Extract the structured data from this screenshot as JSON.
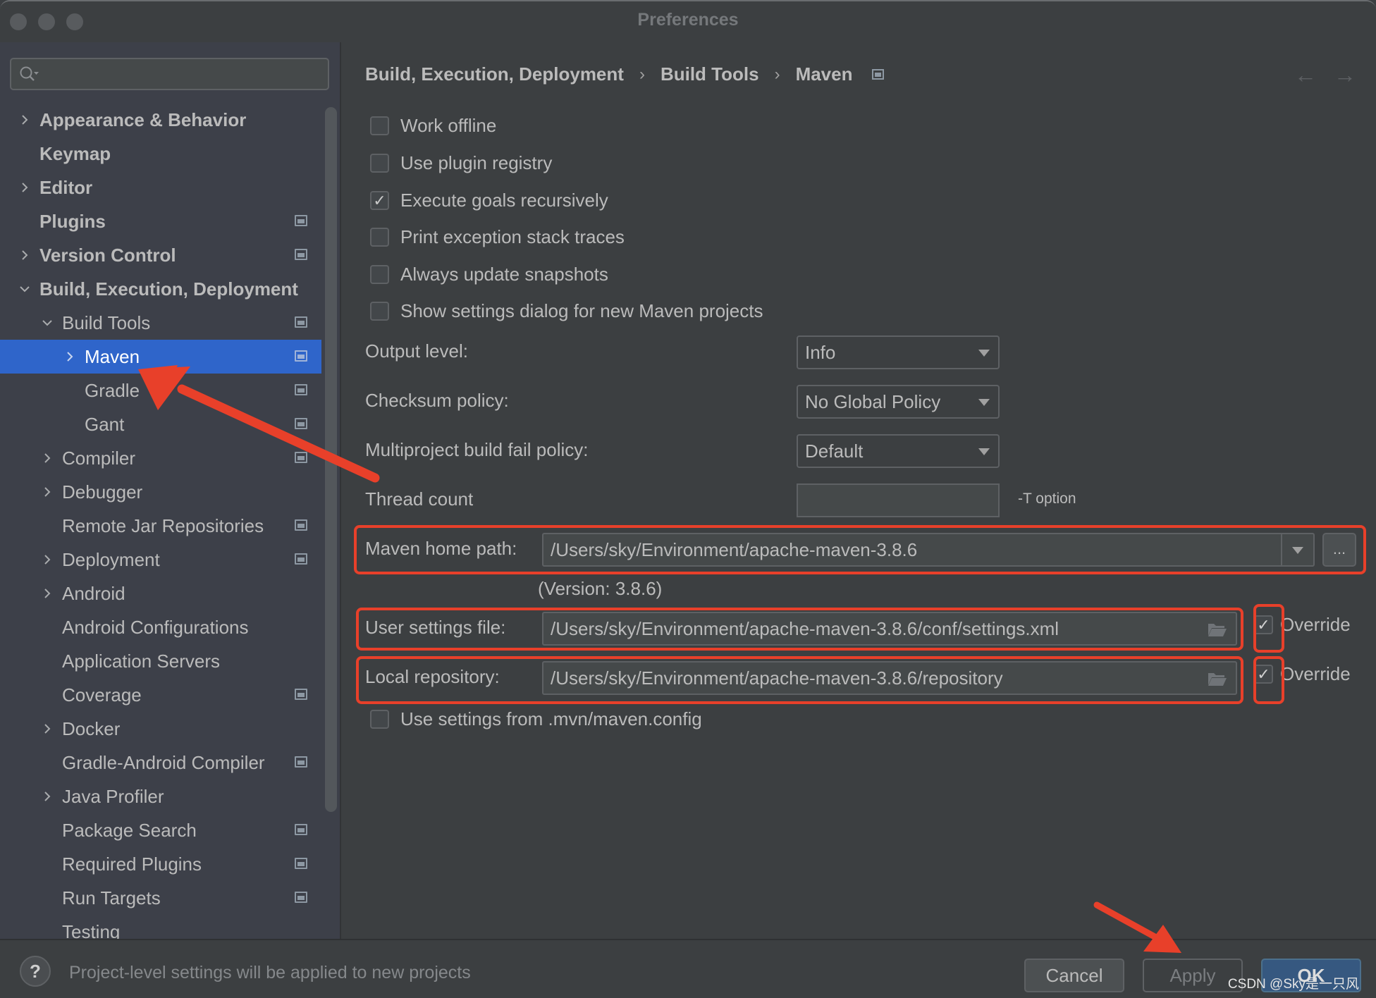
{
  "window": {
    "title": "Preferences"
  },
  "sidebar": {
    "search_placeholder": "",
    "items": [
      {
        "label": "Appearance & Behavior",
        "level": 0,
        "bold": true,
        "expander": "collapsed",
        "project_icon": false
      },
      {
        "label": "Keymap",
        "level": 0,
        "bold": true,
        "expander": "none",
        "project_icon": false
      },
      {
        "label": "Editor",
        "level": 0,
        "bold": true,
        "expander": "collapsed",
        "project_icon": false
      },
      {
        "label": "Plugins",
        "level": 0,
        "bold": true,
        "expander": "none",
        "project_icon": true
      },
      {
        "label": "Version Control",
        "level": 0,
        "bold": true,
        "expander": "collapsed",
        "project_icon": true
      },
      {
        "label": "Build, Execution, Deployment",
        "level": 0,
        "bold": true,
        "expander": "expanded",
        "project_icon": false
      },
      {
        "label": "Build Tools",
        "level": 1,
        "bold": false,
        "expander": "expanded",
        "project_icon": true
      },
      {
        "label": "Maven",
        "level": 2,
        "bold": false,
        "expander": "collapsed",
        "project_icon": true,
        "selected": true
      },
      {
        "label": "Gradle",
        "level": 2,
        "bold": false,
        "expander": "none",
        "project_icon": true
      },
      {
        "label": "Gant",
        "level": 2,
        "bold": false,
        "expander": "none",
        "project_icon": true
      },
      {
        "label": "Compiler",
        "level": 1,
        "bold": false,
        "expander": "collapsed",
        "project_icon": true
      },
      {
        "label": "Debugger",
        "level": 1,
        "bold": false,
        "expander": "collapsed",
        "project_icon": false
      },
      {
        "label": "Remote Jar Repositories",
        "level": 1,
        "bold": false,
        "expander": "none",
        "project_icon": true
      },
      {
        "label": "Deployment",
        "level": 1,
        "bold": false,
        "expander": "collapsed",
        "project_icon": true
      },
      {
        "label": "Android",
        "level": 1,
        "bold": false,
        "expander": "collapsed",
        "project_icon": false
      },
      {
        "label": "Android Configurations",
        "level": 1,
        "bold": false,
        "expander": "none",
        "project_icon": false
      },
      {
        "label": "Application Servers",
        "level": 1,
        "bold": false,
        "expander": "none",
        "project_icon": false
      },
      {
        "label": "Coverage",
        "level": 1,
        "bold": false,
        "expander": "none",
        "project_icon": true
      },
      {
        "label": "Docker",
        "level": 1,
        "bold": false,
        "expander": "collapsed",
        "project_icon": false
      },
      {
        "label": "Gradle-Android Compiler",
        "level": 1,
        "bold": false,
        "expander": "none",
        "project_icon": true
      },
      {
        "label": "Java Profiler",
        "level": 1,
        "bold": false,
        "expander": "collapsed",
        "project_icon": false
      },
      {
        "label": "Package Search",
        "level": 1,
        "bold": false,
        "expander": "none",
        "project_icon": true
      },
      {
        "label": "Required Plugins",
        "level": 1,
        "bold": false,
        "expander": "none",
        "project_icon": true
      },
      {
        "label": "Run Targets",
        "level": 1,
        "bold": false,
        "expander": "none",
        "project_icon": true
      },
      {
        "label": "Testing",
        "level": 1,
        "bold": false,
        "expander": "none",
        "project_icon": false
      }
    ]
  },
  "breadcrumb": [
    "Build, Execution, Deployment",
    "Build Tools",
    "Maven"
  ],
  "nav": {
    "back_icon": "←",
    "forward_icon": "→"
  },
  "options": [
    {
      "label": "Work offline",
      "checked": false
    },
    {
      "label": "Use plugin registry",
      "checked": false
    },
    {
      "label": "Execute goals recursively",
      "checked": true
    },
    {
      "label": "Print exception stack traces",
      "checked": false
    },
    {
      "label": "Always update snapshots",
      "checked": false
    },
    {
      "label": "Show settings dialog for new Maven projects",
      "checked": false
    }
  ],
  "fields": {
    "output_level": {
      "label": "Output level:",
      "value": "Info"
    },
    "checksum_policy": {
      "label": "Checksum policy:",
      "value": "No Global Policy"
    },
    "multiproject_fail": {
      "label": "Multiproject build fail policy:",
      "value": "Default"
    },
    "thread_count": {
      "label": "Thread count",
      "value": "",
      "hint": "-T option"
    },
    "maven_home": {
      "label": "Maven home path:",
      "value": "/Users/sky/Environment/apache-maven-3.8.6",
      "browse_label": "...",
      "version": "(Version: 3.8.6)"
    },
    "user_settings": {
      "label": "User settings file:",
      "value": "/Users/sky/Environment/apache-maven-3.8.6/conf/settings.xml",
      "override_label": "Override",
      "override_checked": true
    },
    "local_repo": {
      "label": "Local repository:",
      "value": "/Users/sky/Environment/apache-maven-3.8.6/repository",
      "override_label": "Override",
      "override_checked": true
    },
    "use_mvn_config": {
      "label": "Use settings from .mvn/maven.config",
      "checked": false
    }
  },
  "footer": {
    "help_label": "?",
    "note": "Project-level settings will be applied to new projects",
    "cancel": "Cancel",
    "apply": "Apply",
    "ok": "OK"
  },
  "watermark": "CSDN @Sky是一只风",
  "colors": {
    "selection": "#2f65ca",
    "annotation": "#e8402a",
    "ok_button": "#365880"
  }
}
